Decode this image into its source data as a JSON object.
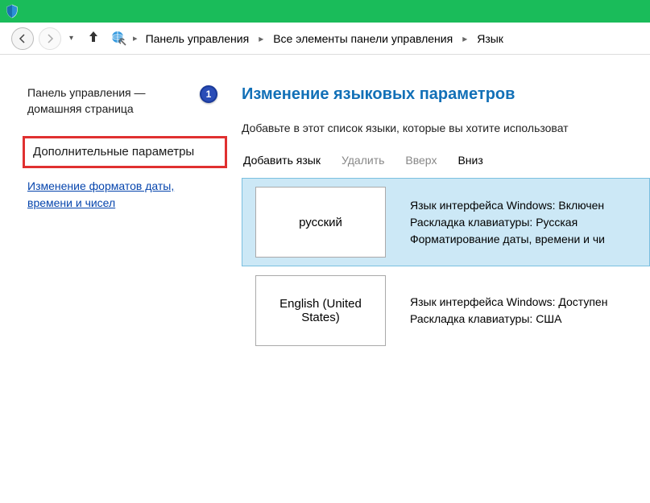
{
  "titlebar": {},
  "nav": {
    "breadcrumb": [
      "Панель управления",
      "Все элементы панели управления",
      "Язык"
    ]
  },
  "sidebar": {
    "home_link": "Панель управления — домашняя страница",
    "step_number": "1",
    "advanced_link": "Дополнительные параметры",
    "formats_link": "Изменение форматов даты, времени и чисел"
  },
  "main": {
    "title": "Изменение языковых параметров",
    "description": "Добавьте в этот список языки, которые вы хотите использоват",
    "toolbar": {
      "add": "Добавить язык",
      "remove": "Удалить",
      "up": "Вверх",
      "down": "Вниз"
    },
    "languages": [
      {
        "name": "русский",
        "lines": [
          "Язык интерфейса Windows: Включен",
          "Раскладка клавиатуры: Русская",
          "Форматирование даты, времени и чи"
        ],
        "selected": true
      },
      {
        "name": "English (United States)",
        "lines": [
          "Язык интерфейса Windows: Доступен",
          "Раскладка клавиатуры: США"
        ],
        "selected": false
      }
    ]
  }
}
